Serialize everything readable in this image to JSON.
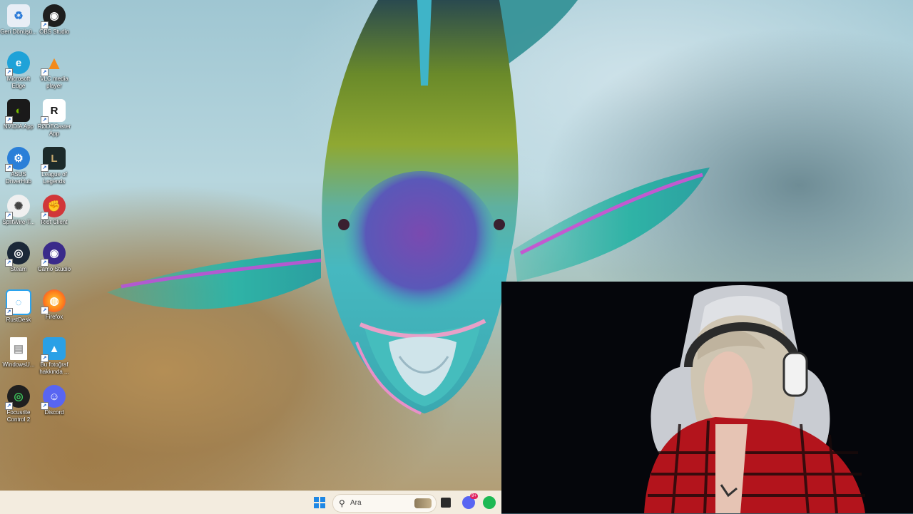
{
  "desktop": {
    "icons": [
      {
        "label": "Geri Dönüşü...",
        "icon": "recycle-bin-icon",
        "color": "#e8eef6",
        "glyph": "♻"
      },
      {
        "label": "OBS Studio",
        "icon": "obs-icon",
        "color": "#1e1e1e",
        "glyph": "◉"
      },
      {
        "label": "Microsoft Edge",
        "icon": "edge-icon",
        "color": "#1fa2d8",
        "glyph": "e"
      },
      {
        "label": "VLC media player",
        "icon": "vlc-icon",
        "color": "#f28a1c",
        "glyph": "▲"
      },
      {
        "label": "NVIDIA App",
        "icon": "nvidia-icon",
        "color": "#1a1a1a",
        "glyph": "◐"
      },
      {
        "label": "RØDECaster App",
        "icon": "rodecaster-icon",
        "color": "#ffffff",
        "glyph": "R"
      },
      {
        "label": "ASUS DriverHub",
        "icon": "asus-driverhub-icon",
        "color": "#2a7fd8",
        "glyph": "⚙"
      },
      {
        "label": "League of Legends",
        "icon": "league-of-legends-icon",
        "color": "#1c2a2a",
        "glyph": "L"
      },
      {
        "label": "SplitWire-T...",
        "icon": "splitwire-icon",
        "color": "#f0f0f0",
        "glyph": "✺"
      },
      {
        "label": "Riot Client",
        "icon": "riot-client-icon",
        "color": "#d13639",
        "glyph": "✊"
      },
      {
        "label": "Steam",
        "icon": "steam-icon",
        "color": "#1b2838",
        "glyph": "◎"
      },
      {
        "label": "Camo Studio",
        "icon": "camo-studio-icon",
        "color": "#3a2a8a",
        "glyph": "◉"
      },
      {
        "label": "RustDesk",
        "icon": "rustdesk-icon",
        "color": "#2aa3ef",
        "glyph": "◌"
      },
      {
        "label": "Firefox",
        "icon": "firefox-icon",
        "color": "#ff7a1a",
        "glyph": "◍"
      },
      {
        "label": "WindowsU...",
        "icon": "document-icon",
        "color": "#ffffff",
        "glyph": "▤"
      },
      {
        "label": "Bu fotoğraf hakkında ...",
        "icon": "photo-info-icon",
        "color": "#2aa0e6",
        "glyph": "▲"
      },
      {
        "label": "Focusrite Control 2",
        "icon": "focusrite-icon",
        "color": "#1f1f1f",
        "glyph": "◎"
      },
      {
        "label": "Discord",
        "icon": "discord-icon",
        "color": "#5865f2",
        "glyph": "☺"
      }
    ]
  },
  "taskbar": {
    "search_placeholder": "Ara",
    "search_icon": "search-icon",
    "start_icon": "windows-start-icon",
    "apps": [
      {
        "name": "file-explorer-icon"
      },
      {
        "name": "discord-icon",
        "badge": "9+"
      },
      {
        "name": "spotify-icon"
      }
    ]
  },
  "colors": {
    "taskbar_bg": "#f3ecdf",
    "webcam_bg": "#05060b",
    "start_blue": "#1e88e5"
  }
}
